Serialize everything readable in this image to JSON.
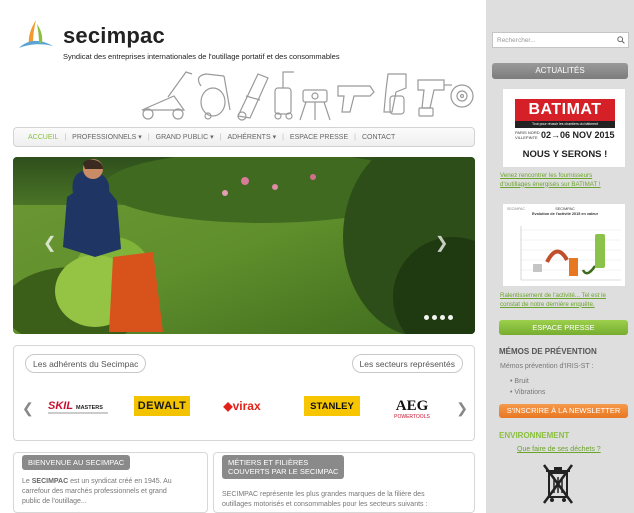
{
  "header": {
    "brand": "secimpac",
    "tagline": "Syndicat des entreprises internationales de l'outillage portatif et des consommables"
  },
  "nav": {
    "items": [
      {
        "label": "ACCUEIL"
      },
      {
        "label": "PROFESSIONNELS ▾"
      },
      {
        "label": "GRAND PUBLIC ▾"
      },
      {
        "label": "ADHÉRENTS ▾"
      },
      {
        "label": "ESPACE PRESSE"
      },
      {
        "label": "CONTACT"
      }
    ]
  },
  "brands": {
    "left_pill": "Les adhérents du Secimpac",
    "right_pill": "Les secteurs représentés",
    "logos": [
      {
        "label": "SKIL MASTERS"
      },
      {
        "label": "DeWALT"
      },
      {
        "label": "virax"
      },
      {
        "label": "STANLEY"
      },
      {
        "label": "AEG"
      }
    ]
  },
  "box1": {
    "heading": "BIENVENUE AU SECIMPAC",
    "line1": "Le SECIMPAC est un syndicat créé en 1945. Au",
    "line2": "carrefour des marchés professionnels et grand",
    "line3": "public de l'outillage..."
  },
  "box2": {
    "heading1": "MÉTIERS ET FILIÈRES",
    "heading2": "COUVERTS PAR LE SECIMPAC",
    "line1": "SECIMPAC représente les plus grandes marques de la filière des",
    "line2": "outillages motorisés et consommables pour les secteurs suivants :"
  },
  "sidebar": {
    "search_placeholder": "Rechercher...",
    "news_title": "ACTUALITÉS",
    "batimat": {
      "logo": "BATIMAT",
      "subtitle": "Tout pour réussir les chantiers du bâtiment",
      "venue": "PARIS NORD VILLEPINTE",
      "dates": "02→06 NOV 2015",
      "headline": "NOUS Y SERONS !"
    },
    "news1_line1": "Venez rencontrer les fournisseurs",
    "news1_line2": "d'outillages énergisés sur BATIMAT !",
    "chart_card": {
      "brand": "SECIMPAC",
      "title1": "SECIMPAC",
      "title2": "Evolution de l'activité 2015 en valeur"
    },
    "news2_line1": "Ralentissement de l'activité... Tel est le",
    "news2_line2": "constat de notre dernière enquête.",
    "press_button": "ESPACE PRESSE",
    "memos_title": "MÉMOS DE PRÉVENTION",
    "memos_sub": "Mémos prévention d'IRIS-ST :",
    "memos": [
      "Bruit",
      "Vibrations"
    ],
    "newsletter_button": "S'INSCRIRE À LA NEWSLETTER",
    "env_title": "ENVIRONNEMENT",
    "env_link": "Que faire de ses déchets ?"
  },
  "colors": {
    "green": "#8bbf3f",
    "orange": "#e87722",
    "batimat_red": "#d52027"
  }
}
